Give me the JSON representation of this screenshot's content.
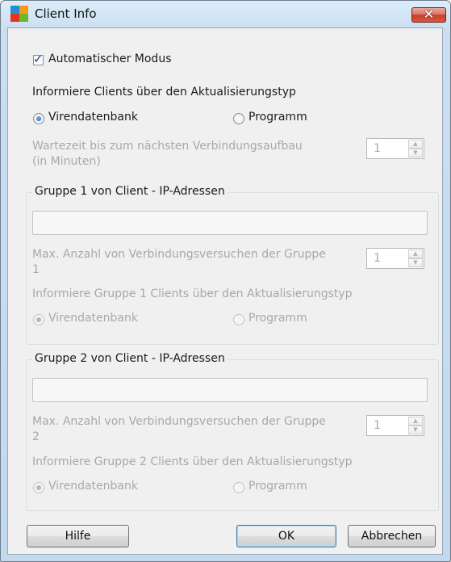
{
  "window": {
    "title": "Client Info",
    "close_symbol": "✕"
  },
  "auto_mode": {
    "label": "Automatischer Modus",
    "checked": true
  },
  "inform_clients": {
    "heading": "Informiere Clients über den Aktualisierungstyp",
    "options": [
      "Virendatenbank",
      "Programm"
    ],
    "selected": "Virendatenbank"
  },
  "wait_time": {
    "label_line1": "Wartezeit bis zum nächsten Verbindungsaufbau",
    "label_line2": "(in Minuten)",
    "value": "1"
  },
  "group1": {
    "title": "Gruppe 1 von Client - IP-Adressen",
    "ip_value": "",
    "max_attempts_label_line1": "Max. Anzahl von Verbindungsversuchen der Gruppe",
    "max_attempts_label_line2": "1",
    "max_attempts_value": "1",
    "inform_heading": "Informiere Gruppe 1 Clients über den Aktualisierungstyp",
    "options": [
      "Virendatenbank",
      "Programm"
    ],
    "selected": "Virendatenbank"
  },
  "group2": {
    "title": "Gruppe 2 von Client - IP-Adressen",
    "ip_value": "",
    "max_attempts_label_line1": "Max. Anzahl von Verbindungsversuchen der Gruppe",
    "max_attempts_label_line2": "2",
    "max_attempts_value": "1",
    "inform_heading": "Informiere Gruppe 2 Clients über den Aktualisierungstyp",
    "options": [
      "Virendatenbank",
      "Programm"
    ],
    "selected": "Virendatenbank"
  },
  "buttons": {
    "help": "Hilfe",
    "ok": "OK",
    "cancel": "Abbrechen"
  },
  "colors": {
    "titlebar": "#c9def1",
    "close_button": "#c7402c",
    "dialog_bg": "#f0f0f0",
    "disabled_text": "#a8a8a8"
  }
}
